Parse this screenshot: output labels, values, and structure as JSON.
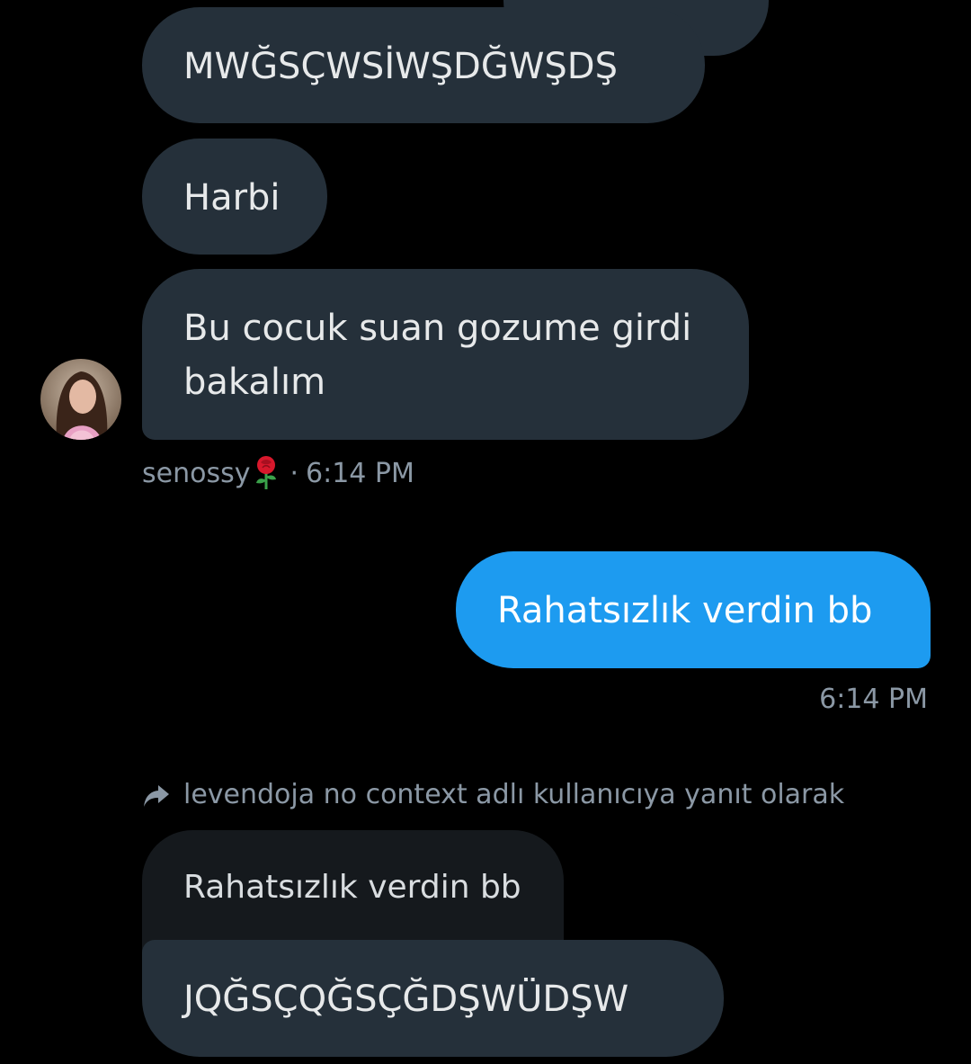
{
  "messages": {
    "m1": "MWĞSÇWSİWŞDĞWŞDŞ",
    "m2": "Harbi",
    "m3_line1": "Bu cocuk suan gozume girdi",
    "m3_line2": "bakalım",
    "received_meta": {
      "username": "senossy",
      "emoji": "rose",
      "separator": "·",
      "time": "6:14 PM"
    },
    "sent": {
      "text": "Rahatsızlık verdin bb",
      "time": "6:14 PM"
    },
    "reply_context": "levendoja no context adlı kullanıcıya yanıt olarak",
    "quoted_text": "Rahatsızlık verdin bb",
    "m4": "JQĞSÇQĞSÇĞDŞWÜDŞW"
  },
  "colors": {
    "background": "#000000",
    "received_bubble": "#25303a",
    "sent_bubble": "#1d9bf0",
    "quoted_bubble": "#15191d",
    "meta_text": "#8b98a5"
  }
}
